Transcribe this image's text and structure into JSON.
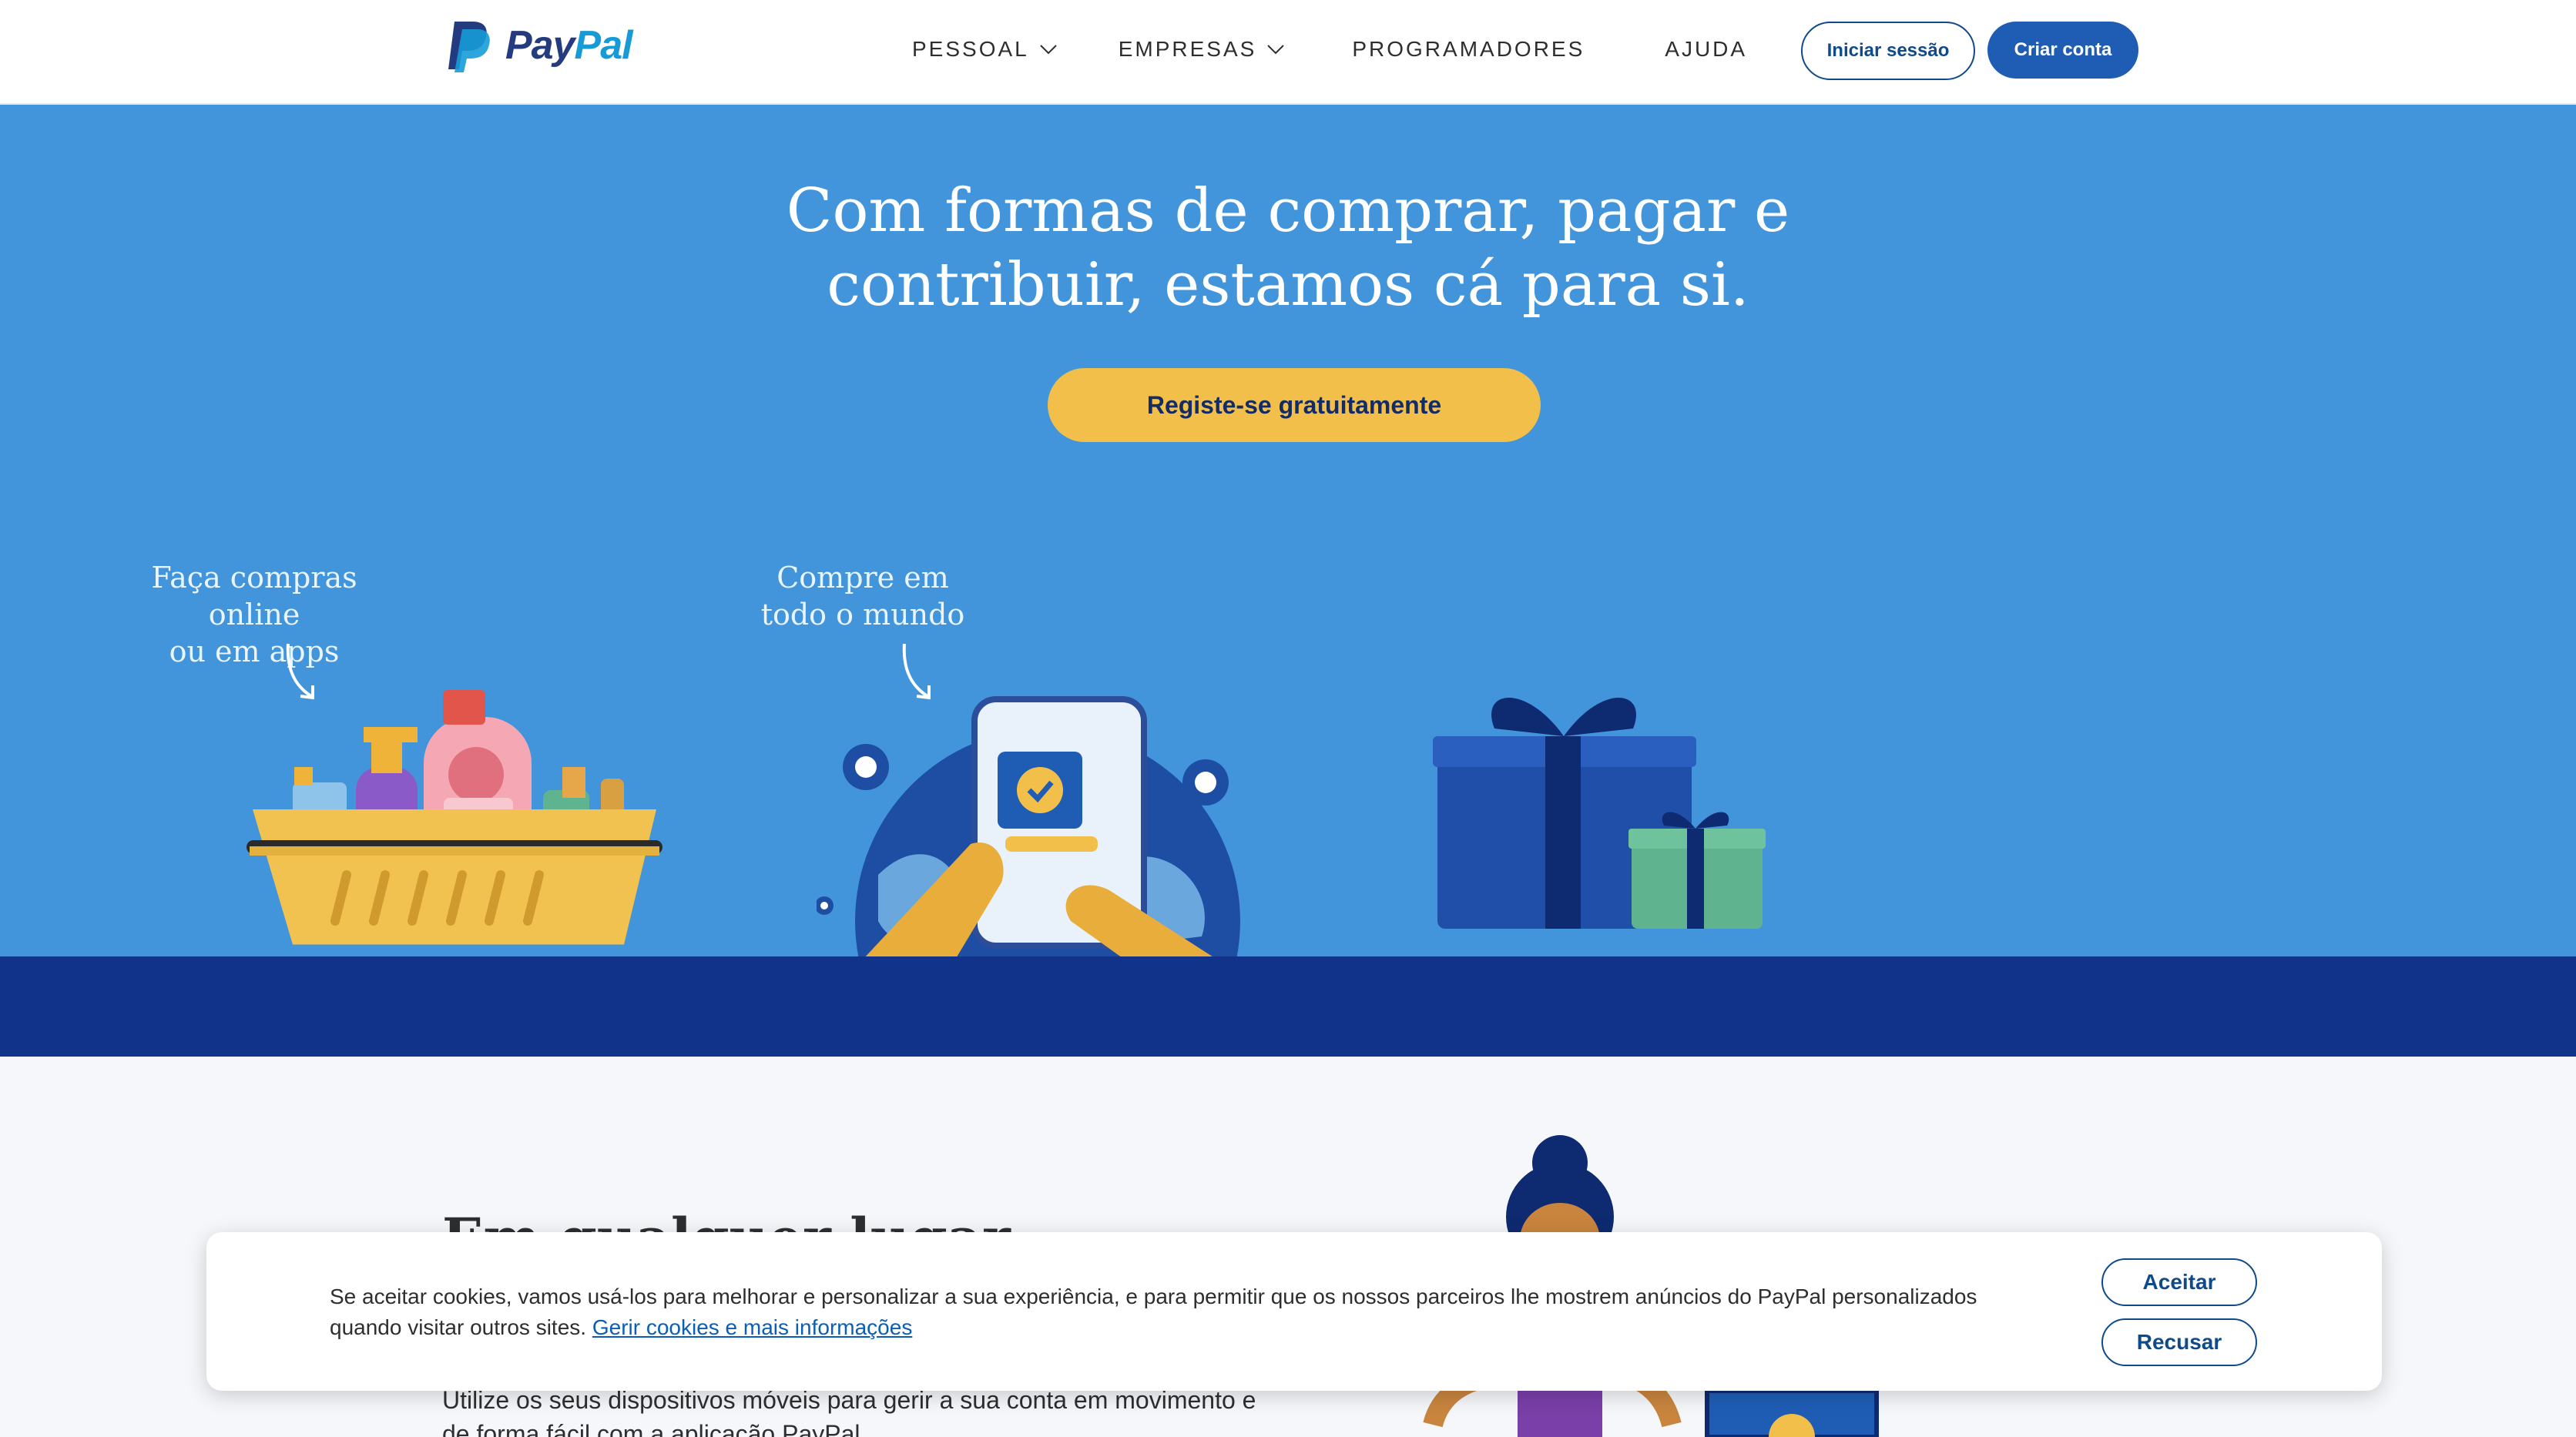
{
  "brand": {
    "pay": "Pay",
    "pal": "Pal",
    "icon": "paypal-logo-icon"
  },
  "nav": {
    "items": [
      {
        "label": "PESSOAL",
        "dropdown": true
      },
      {
        "label": "EMPRESAS",
        "dropdown": true
      },
      {
        "label": "PROGRAMADORES",
        "dropdown": false
      },
      {
        "label": "AJUDA",
        "dropdown": false
      }
    ],
    "login_label": "Iniciar sessão",
    "signup_label": "Criar conta"
  },
  "hero": {
    "title_line1": "Com formas de comprar, pagar e",
    "title_line2": "contribuir, estamos cá para si.",
    "cta_label": "Registe-se gratuitamente",
    "captions": [
      {
        "line1": "Faça compras online",
        "line2": "ou em apps"
      },
      {
        "line1": "Compre em",
        "line2": "todo o mundo"
      }
    ]
  },
  "section": {
    "title": "Em qualquer lugar",
    "body_line1": "Utilize os seus dispositivos móveis para gerir a sua conta em movimento e",
    "body_line2": "de forma fácil com a aplicação PayPal."
  },
  "cookie": {
    "text_line1": "Se aceitar cookies, vamos usá-los para melhorar e personalizar a sua experiência, e para permitir que os nossos parceiros lhe mostrem anúncios do PayPal personalizados",
    "text_line2": "quando visitar outros sites.",
    "link_label": "Gerir cookies e mais informações",
    "accept_label": "Aceitar",
    "decline_label": "Recusar"
  },
  "colors": {
    "hero_bg": "#4295db",
    "hero_floor": "#12338a",
    "cta": "#f2c04a",
    "primary_button": "#1f5db5"
  }
}
